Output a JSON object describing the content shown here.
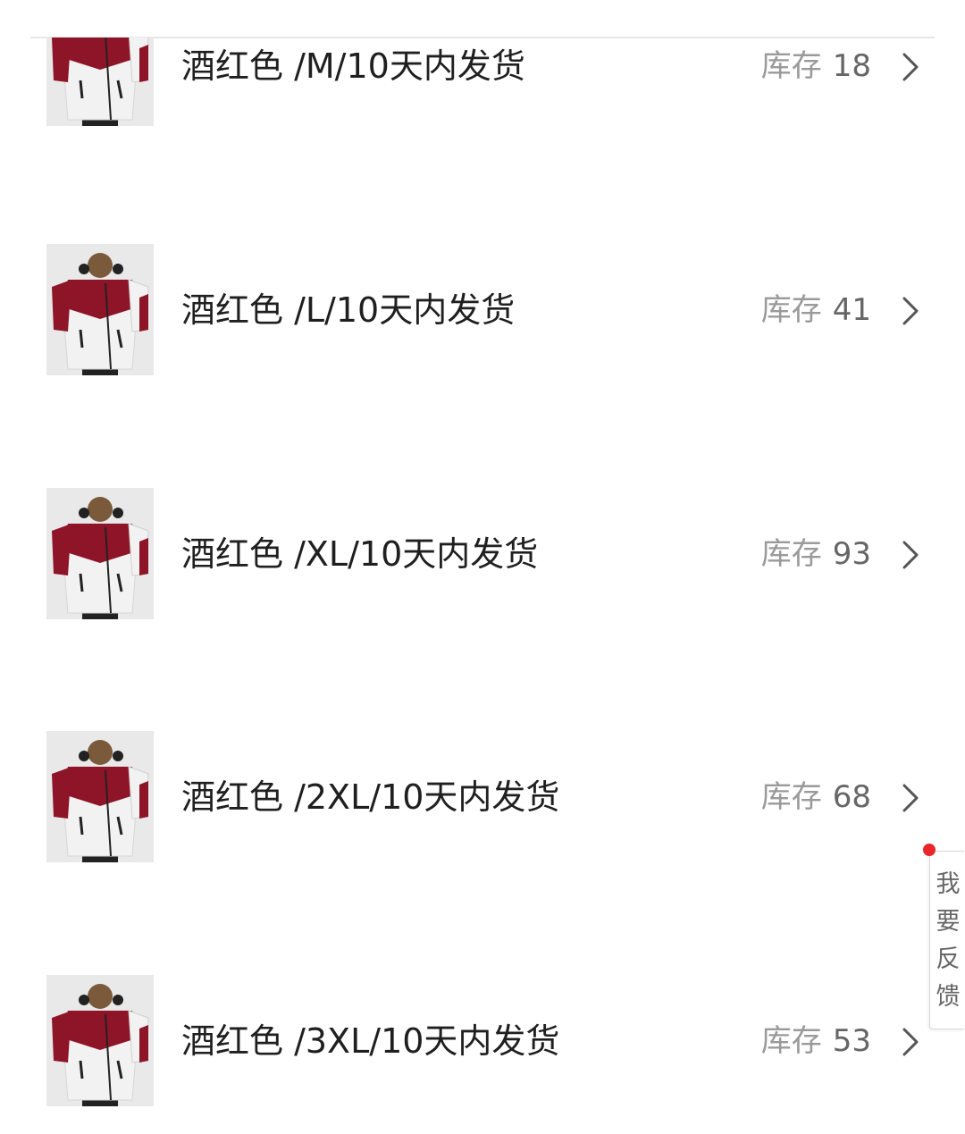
{
  "sku_list": {
    "items": [
      {
        "name": "酒红色 /M/10天内发货",
        "stock_label": "库存",
        "stock": "18"
      },
      {
        "name": "酒红色 /L/10天内发货",
        "stock_label": "库存",
        "stock": "41"
      },
      {
        "name": "酒红色 /XL/10天内发货",
        "stock_label": "库存",
        "stock": "93"
      },
      {
        "name": "酒红色 /2XL/10天内发货",
        "stock_label": "库存",
        "stock": "68"
      },
      {
        "name": "酒红色 /3XL/10天内发货",
        "stock_label": "库存",
        "stock": "53"
      }
    ]
  },
  "feedback_button": {
    "label": "我要反馈"
  },
  "colors": {
    "jacket_red": "#8e1428",
    "jacket_white": "#f1f1f1",
    "text": "#1f1f1f",
    "stock_text": "#9a9a9a",
    "feedback_dot": "#e8262c"
  },
  "icons": {
    "row_arrow": "chevron-right-icon",
    "thumbnail": "burgundy-white-jacket-photo"
  }
}
